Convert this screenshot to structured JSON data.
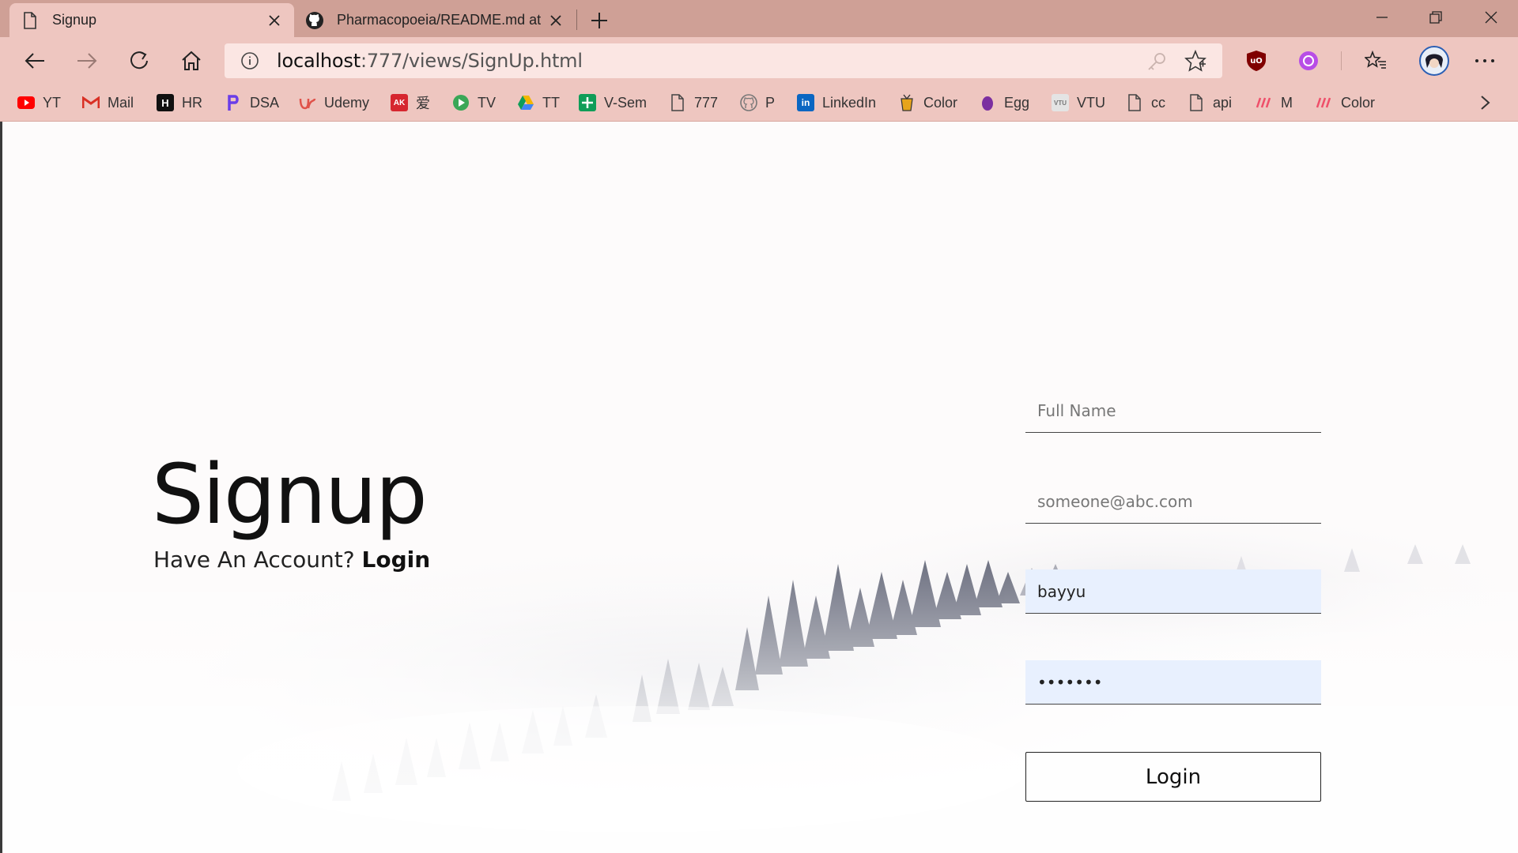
{
  "tabs": [
    {
      "title": "Signup",
      "icon": "page-icon"
    },
    {
      "title": "Pharmacopoeia/README.md at",
      "icon": "github-icon"
    }
  ],
  "address": {
    "host": "localhost",
    "path": ":777/views/SignUp.html"
  },
  "bookmarks": [
    {
      "label": "YT",
      "icon": "youtube-icon",
      "color": "#ff0000"
    },
    {
      "label": "Mail",
      "icon": "gmail-icon",
      "color": "#d93025"
    },
    {
      "label": "HR",
      "icon": "hackerrank-icon",
      "color": "#111111"
    },
    {
      "label": "DSA",
      "icon": "dsa-icon",
      "color": "#6a3de8"
    },
    {
      "label": "Udemy",
      "icon": "udemy-icon",
      "color": "#e0524a"
    },
    {
      "label": "爱",
      "icon": "anime-icon",
      "color": "#d6262f"
    },
    {
      "label": "TV",
      "icon": "play-icon",
      "color": "#3aa757"
    },
    {
      "label": "TT",
      "icon": "drive-icon",
      "color": "#f2b600"
    },
    {
      "label": "V-Sem",
      "icon": "sheets-icon",
      "color": "#0f9d58"
    },
    {
      "label": "777",
      "icon": "page-icon",
      "color": "#555555"
    },
    {
      "label": "P",
      "icon": "github-icon",
      "color": "#555555"
    },
    {
      "label": "LinkedIn",
      "icon": "linkedin-icon",
      "color": "#0a66c2"
    },
    {
      "label": "Color",
      "icon": "color-icon",
      "color": "#e7a41c"
    },
    {
      "label": "Egg",
      "icon": "egg-icon",
      "color": "#7b2fa0"
    },
    {
      "label": "VTU",
      "icon": "vtu-icon",
      "color": "#999999"
    },
    {
      "label": "cc",
      "icon": "page-icon",
      "color": "#555555"
    },
    {
      "label": "api",
      "icon": "page-icon",
      "color": "#555555"
    },
    {
      "label": "M",
      "icon": "m-icon",
      "color": "#ef4f6a"
    },
    {
      "label": "Color",
      "icon": "m-icon",
      "color": "#ef4f6a"
    }
  ],
  "main": {
    "title": "Signup",
    "subtitle": "Have An Account?",
    "login_link": "Login",
    "fields": {
      "fullname_placeholder": "Full Name",
      "email_placeholder": "someone@abc.com",
      "username_value": "bayyu",
      "password_value": "1234567"
    },
    "submit_label": "Login"
  },
  "colors": {
    "tabbar": "#cfa096",
    "toolbar": "#eec6c0",
    "autofill": "#e8f0fe"
  }
}
